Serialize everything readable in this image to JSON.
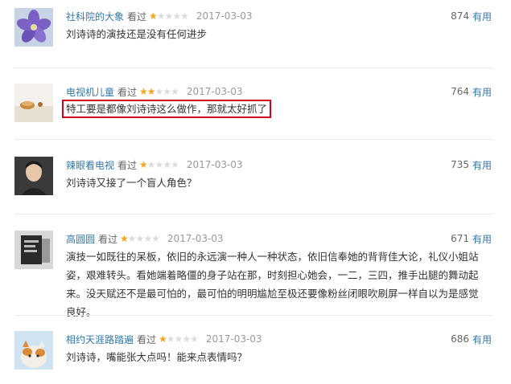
{
  "comments": [
    {
      "user": "社科院的大象",
      "action": "看过",
      "rating": 1,
      "date": "2017-03-03",
      "votes": "874",
      "useful_label": "有用",
      "content": "刘诗诗的演技还是没有任何进步",
      "highlighted": false,
      "avatar": "purple-flower-avatar"
    },
    {
      "user": "电视机儿童",
      "action": "看过",
      "rating": 2,
      "date": "2017-03-03",
      "votes": "764",
      "useful_label": "有用",
      "content": "特工要是都像刘诗诗这么做作，那就太好抓了",
      "highlighted": true,
      "highlight_color": "#d0021b",
      "avatar": "tv-child-avatar"
    },
    {
      "user": "辣眼看电视",
      "action": "看过",
      "rating": 1,
      "date": "2017-03-03",
      "votes": "735",
      "useful_label": "有用",
      "content": "刘诗诗又接了一个盲人角色？",
      "highlighted": false,
      "avatar": "man-portrait-avatar"
    },
    {
      "user": "高圆圆",
      "action": "看过",
      "rating": 1,
      "date": "2017-03-03",
      "votes": "671",
      "useful_label": "有用",
      "content": "演技一如既往的呆板，依旧的永远演一种人一种状态，依旧信奉她的背背佳大论，礼仪小姐站姿，艰难转头。看她端着略僵的身子站在那，时刻担心她会，一二，三四，推手出腿的舞动起来。没天赋还不是最可怕的，最可怕的明明尴尬至极还要像粉丝闭眼吹刷屏一样自以为是感觉良好。",
      "highlighted": false,
      "avatar": "bw-photo-avatar"
    },
    {
      "user": "相约天涯路踏遍",
      "action": "看过",
      "rating": 1,
      "date": "2017-03-03",
      "votes": "686",
      "useful_label": "有用",
      "content": "刘诗诗，嘴能张大点吗！能来点表情吗？",
      "highlighted": false,
      "avatar": "cat-avatar"
    }
  ],
  "colors": {
    "username": "#3377aa",
    "star_on": "#f5a623",
    "star_off": "#dcdcdc",
    "date": "#999999",
    "highlight_border": "#d0021b"
  }
}
